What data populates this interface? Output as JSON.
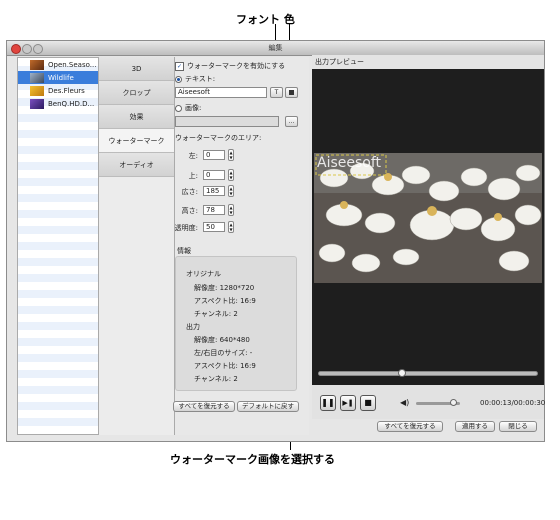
{
  "annotations": {
    "font_color": "フォント 色",
    "select_watermark_image": "ウォーターマーク画像を選択する"
  },
  "window": {
    "title": "編集"
  },
  "files": [
    {
      "name": "Open.Seaso..."
    },
    {
      "name": "Wildlife"
    },
    {
      "name": "Des.Fleurs"
    },
    {
      "name": "BenQ.HD.D..."
    }
  ],
  "tabs": [
    "3D",
    "クロップ",
    "効果",
    "ウォーターマーク",
    "オーディオ"
  ],
  "watermark": {
    "enable_label": "ウォーターマークを有効にする",
    "text_label": "テキスト:",
    "text_value": "Aiseesoft",
    "image_label": "画像:",
    "browse_label": "...",
    "area_label": "ウォーターマークのエリア:",
    "left_label": "左:",
    "left_value": "0",
    "top_label": "上:",
    "top_value": "0",
    "width_label": "広さ:",
    "width_value": "185",
    "height_label": "高さ:",
    "height_value": "78",
    "opacity_label": "透明度:",
    "opacity_value": "50"
  },
  "info": {
    "header": "情報",
    "original_label": "オリジナル",
    "orig_resolution": "解像度: 1280*720",
    "orig_aspect": "アスペクト比: 16:9",
    "orig_channels": "チャンネル: 2",
    "output_label": "出力",
    "out_resolution": "解像度: 640*480",
    "out_lr_size": "左/右目のサイズ: -",
    "out_aspect": "アスペクト比: 16:9",
    "out_channels": "チャンネル: 2"
  },
  "panel_buttons": {
    "restore_all": "すべてを復元する",
    "restore_default": "デフォルトに戻す"
  },
  "preview": {
    "label": "出力プレビュー",
    "watermark_text": "Aiseesoft",
    "time": "00:00:13/00:00:30",
    "progress": 0.38,
    "volume": 0.85
  },
  "footer": {
    "restore_all": "すべてを復元する",
    "apply": "適用する",
    "close": "閉じる"
  },
  "colors": {
    "selection": "#3a7ddb",
    "watermark_text": "#ffffff"
  }
}
